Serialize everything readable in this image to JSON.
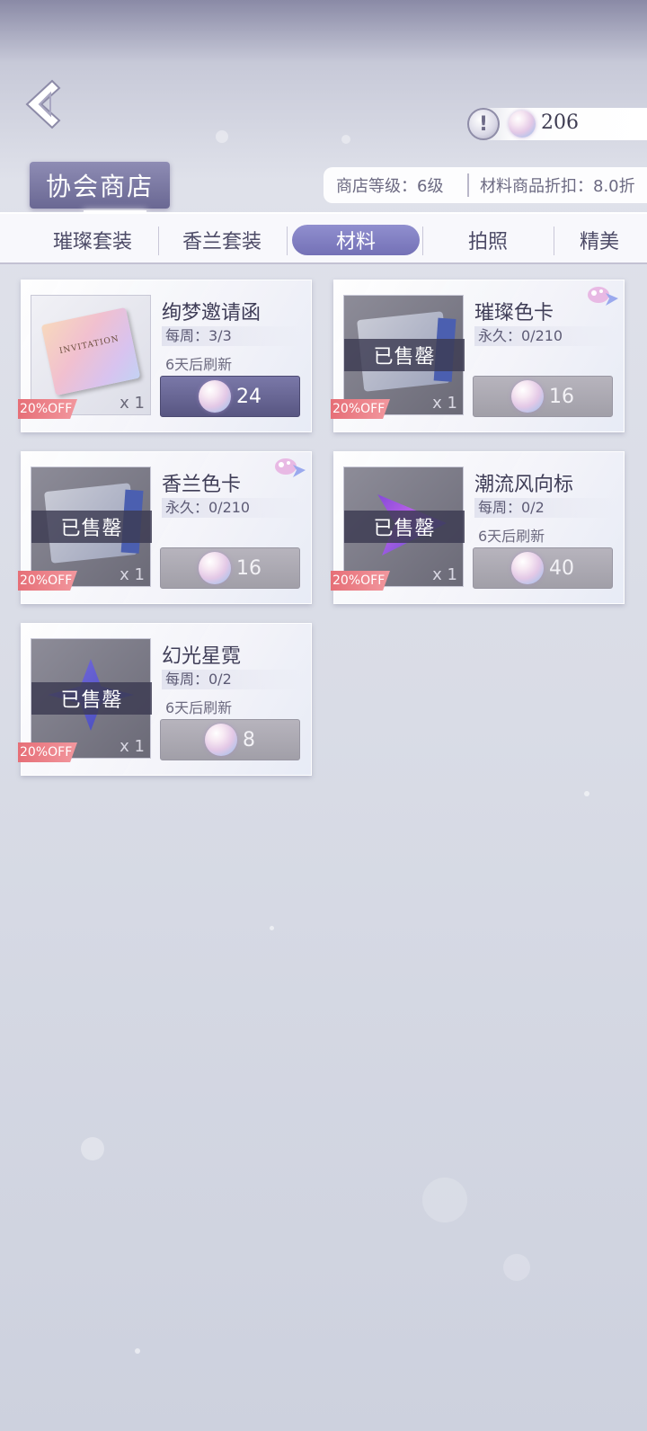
{
  "header": {
    "currency_value": "206",
    "info_symbol": "!"
  },
  "shop": {
    "title": "协会商店",
    "level_text": "商店等级：6级",
    "discount_text": "材料商品折扣：8.0折"
  },
  "tabs": [
    {
      "label": "璀璨套装",
      "active": false
    },
    {
      "label": "香兰套装",
      "active": false
    },
    {
      "label": "材料",
      "active": true
    },
    {
      "label": "拍照",
      "active": false
    },
    {
      "label": "精美",
      "active": false
    }
  ],
  "items": [
    {
      "name": "绚梦邀请函",
      "limit": "每周：3/3",
      "refresh": "6天后刷新",
      "price": "24",
      "qty": "x 1",
      "discount": "20%OFF",
      "sold_out": false,
      "sold_label": "",
      "art_text": "INVITATION"
    },
    {
      "name": "璀璨色卡",
      "limit": "永久：0/210",
      "refresh": "",
      "price": "16",
      "qty": "x 1",
      "discount": "20%OFF",
      "sold_out": true,
      "sold_label": "已售罄",
      "art_text": ""
    },
    {
      "name": "香兰色卡",
      "limit": "永久：0/210",
      "refresh": "",
      "price": "16",
      "qty": "x 1",
      "discount": "20%OFF",
      "sold_out": true,
      "sold_label": "已售罄",
      "art_text": ""
    },
    {
      "name": "潮流风向标",
      "limit": "每周：0/2",
      "refresh": "6天后刷新",
      "price": "40",
      "qty": "x 1",
      "discount": "20%OFF",
      "sold_out": true,
      "sold_label": "已售罄",
      "art_text": ""
    },
    {
      "name": "幻光星霓",
      "limit": "每周：0/2",
      "refresh": "6天后刷新",
      "price": "8",
      "qty": "x 1",
      "discount": "20%OFF",
      "sold_out": true,
      "sold_label": "已售罄",
      "art_text": ""
    }
  ]
}
